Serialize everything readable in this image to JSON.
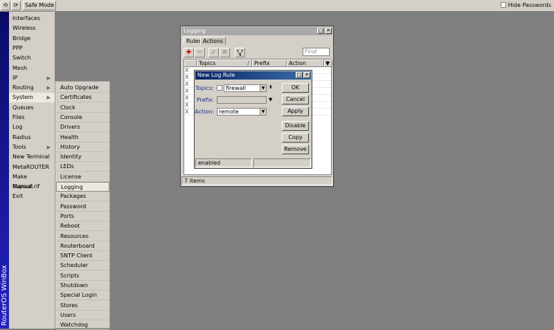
{
  "toolbar": {
    "undo_icon": "undo-icon",
    "redo_icon": "redo-icon",
    "safe_mode": "Safe Mode",
    "hide_passwords": "Hide Passwords"
  },
  "brand": "RouterOS WinBox",
  "menu": [
    {
      "label": "Interfaces",
      "arrow": ""
    },
    {
      "label": "Wireless",
      "arrow": ""
    },
    {
      "label": "Bridge",
      "arrow": ""
    },
    {
      "label": "PPP",
      "arrow": ""
    },
    {
      "label": "Switch",
      "arrow": ""
    },
    {
      "label": "Mesh",
      "arrow": ""
    },
    {
      "label": "IP",
      "arrow": "▶"
    },
    {
      "label": "Routing",
      "arrow": "▶"
    },
    {
      "label": "System",
      "arrow": "▶"
    },
    {
      "label": "Queues",
      "arrow": ""
    },
    {
      "label": "Files",
      "arrow": ""
    },
    {
      "label": "Log",
      "arrow": ""
    },
    {
      "label": "Radius",
      "arrow": ""
    },
    {
      "label": "Tools",
      "arrow": "▶"
    },
    {
      "label": "New Terminal",
      "arrow": ""
    },
    {
      "label": "MetaROUTER",
      "arrow": ""
    },
    {
      "label": "Make Supout.rif",
      "arrow": ""
    },
    {
      "label": "Manual",
      "arrow": ""
    },
    {
      "label": "Exit",
      "arrow": ""
    }
  ],
  "submenu": [
    "Auto Upgrade",
    "Certificates",
    "Clock",
    "Console",
    "Drivers",
    "Health",
    "History",
    "Identity",
    "LEDs",
    "License",
    "Logging",
    "Packages",
    "Password",
    "Ports",
    "Reboot",
    "Resources",
    "Routerboard",
    "SNTP Client",
    "Scheduler",
    "Scripts",
    "Shutdown",
    "Special Login",
    "Stores",
    "Users",
    "Watchdog"
  ],
  "logging_window": {
    "title": "Logging",
    "tabs": [
      "Rules",
      "Actions"
    ],
    "find_placeholder": "Find",
    "columns": [
      "Topics",
      "Prefix",
      "Action"
    ],
    "status": "7 items",
    "row_mark": "X"
  },
  "rule_window": {
    "title": "New Log Rule",
    "topics_label": "Topics:",
    "topics_value": "firewall",
    "prefix_label": "Prefix:",
    "prefix_value": "",
    "action_label": "Action:",
    "action_value": "remote",
    "buttons": [
      "OK",
      "Cancel",
      "Apply",
      "Disable",
      "Copy",
      "Remove"
    ],
    "status": "enabled"
  }
}
